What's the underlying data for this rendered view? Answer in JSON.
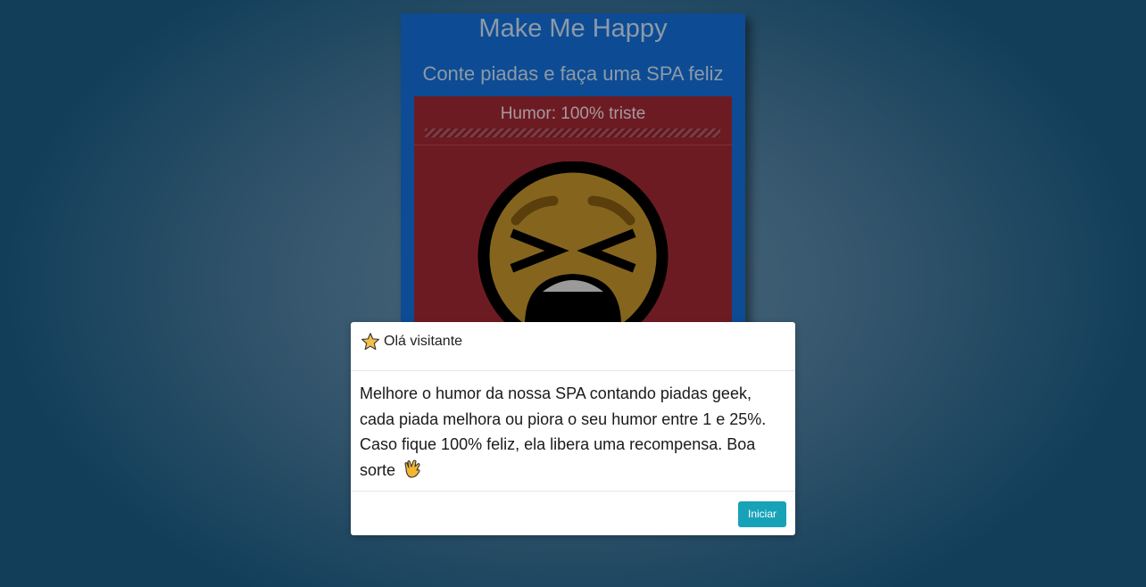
{
  "app": {
    "title": "Make Me Happy",
    "subtitle": "Conte piadas e faça uma SPA feliz",
    "mood_label": "Humor: 100% triste",
    "mood_percent_sad": 100,
    "mood_face_icon": "tired-face-icon",
    "colors": {
      "card_bg": "#0d4c94",
      "panel_bg": "#6d1b22",
      "face": "#85651d"
    }
  },
  "modal": {
    "title_icon": "star-icon",
    "title": "Olá visitante",
    "body": "Melhore o humor da nossa SPA contando piadas geek, cada piada melhora ou piora o seu humor entre 1 e 25%. Caso fique 100% feliz, ela libera uma recompensa. Boa sorte",
    "body_icon": "vulcan-salute-icon",
    "start_button": "Iniciar",
    "colors": {
      "button_bg": "#17a2b8"
    }
  }
}
